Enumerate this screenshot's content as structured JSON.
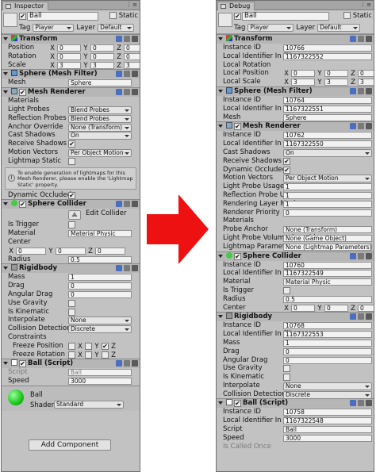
{
  "colors": {
    "panel": "#c2c2c2",
    "accent_arrow": "#ee1111"
  },
  "inspector": {
    "tab_title": "Inspector",
    "go_name": "Ball",
    "static_label": "Static",
    "tag_label": "Tag",
    "tag_value": "Player",
    "layer_label": "Layer",
    "layer_value": "Default",
    "transform": {
      "title": "Transform",
      "rows": [
        {
          "label": "Position",
          "x": "0",
          "y": "0",
          "z": "0"
        },
        {
          "label": "Rotation",
          "x": "0",
          "y": "0",
          "z": "0"
        },
        {
          "label": "Scale",
          "x": "3",
          "y": "3",
          "z": "3"
        }
      ]
    },
    "mesh_filter": {
      "title": "Sphere (Mesh Filter)",
      "mesh_label": "Mesh",
      "mesh_value": "Sphere"
    },
    "mesh_renderer": {
      "title": "Mesh Renderer",
      "rows": [
        {
          "label": "Materials",
          "value": ""
        },
        {
          "label": "Light Probes",
          "value": "Blend Probes"
        },
        {
          "label": "Reflection Probes",
          "value": "Blend Probes"
        },
        {
          "label": "Anchor Override",
          "value": "None (Transform)"
        },
        {
          "label": "Cast Shadows",
          "value": "On"
        },
        {
          "label": "Receive Shadows",
          "value": ""
        },
        {
          "label": "Motion Vectors",
          "value": "Per Object Motion"
        },
        {
          "label": "Lightmap Static",
          "value": ""
        }
      ],
      "help": "To enable generation of lightmaps for this Mesh Renderer, please enable the 'Lightmap Static' property.",
      "dynamic_occluded": "Dynamic Occluded"
    },
    "sphere_collider": {
      "title": "Sphere Collider",
      "edit_collider": "Edit Collider",
      "is_trigger": "Is Trigger",
      "material_label": "Material",
      "material_value": "Material Physic",
      "center_label": "Center",
      "cx": "0",
      "cy": "0",
      "cz": "0",
      "radius_label": "Radius",
      "radius_value": "0.5"
    },
    "rigidbody": {
      "title": "Rigidbody",
      "rows": [
        {
          "label": "Mass",
          "value": "1"
        },
        {
          "label": "Drag",
          "value": "0"
        },
        {
          "label": "Angular Drag",
          "value": "0"
        }
      ],
      "use_gravity": "Use Gravity",
      "is_kinematic": "Is Kinematic",
      "interpolate_label": "Interpolate",
      "interpolate_value": "None",
      "collision_label": "Collision Detection",
      "collision_value": "Discrete",
      "constraints": "Constraints",
      "freeze_pos": "Freeze Position",
      "freeze_rot": "Freeze Rotation"
    },
    "script": {
      "title": "Ball (Script)",
      "script_label": "Script",
      "script_value": "Ball",
      "speed_label": "Speed",
      "speed_value": "3000"
    },
    "material": {
      "name": "Ball",
      "shader_label": "Shader",
      "shader_value": "Standard"
    },
    "add_component": "Add Component"
  },
  "debug": {
    "tab_title": "Debug",
    "go_name": "Ball",
    "static_label": "Static",
    "tag_label": "Tag",
    "tag_value": "Player",
    "layer_label": "Layer",
    "layer_value": "Default",
    "transform": {
      "title": "Transform",
      "instance_id": "10766",
      "local_id": "1167322552",
      "instance_label": "Instance ID",
      "local_label": "Local Identifier In File",
      "rot_label": "Local Rotation",
      "pos_label": "Local Position",
      "scale_label": "Local Scale",
      "px": "0",
      "py": "0",
      "pz": "0",
      "sx": "3",
      "sy": "3",
      "sz": "3"
    },
    "mesh_filter": {
      "title": "Sphere (Mesh Filter)",
      "instance_id": "10764",
      "local_id": "1167322551",
      "mesh_label": "Mesh",
      "mesh_value": "Sphere"
    },
    "mesh_renderer": {
      "title": "Mesh Renderer",
      "instance_id": "10762",
      "local_id": "1167322550",
      "rows": [
        {
          "label": "Cast Shadows",
          "value": "On"
        },
        {
          "label": "Receive Shadows",
          "value": ""
        },
        {
          "label": "Dynamic Occludee",
          "value": ""
        },
        {
          "label": "Motion Vectors",
          "value": "Per Object Motion"
        },
        {
          "label": "Light Probe Usage",
          "value": "1"
        },
        {
          "label": "Reflection Probe Usage",
          "value": "1"
        },
        {
          "label": "Rendering Layer Mask",
          "value": "1"
        },
        {
          "label": "Renderer Priority",
          "value": "0"
        },
        {
          "label": "Materials",
          "value": ""
        },
        {
          "label": "Probe Anchor",
          "value": "None (Transform)"
        },
        {
          "label": "Light Probe Volume Override",
          "value": "None (Game Object)"
        },
        {
          "label": "Lightmap Parameters",
          "value": "None (Lightmap Parameters)"
        }
      ]
    },
    "sphere_collider": {
      "title": "Sphere Collider",
      "instance_id": "10760",
      "local_id": "1167322549",
      "material_value": "Material Physic",
      "radius_value": "0.5",
      "is_trigger": "Is Trigger",
      "material_label": "Material",
      "radius_label": "Radius",
      "center_label": "Center",
      "cx": "0",
      "cy": "0",
      "cz": "0"
    },
    "rigidbody": {
      "title": "Rigidbody",
      "instance_id": "10768",
      "local_id": "1167322553",
      "rows": [
        {
          "label": "Mass",
          "value": "1"
        },
        {
          "label": "Drag",
          "value": "0"
        },
        {
          "label": "Angular Drag",
          "value": "0"
        }
      ],
      "use_gravity": "Use Gravity",
      "is_kinematic": "Is Kinematic",
      "interpolate_label": "Interpolate",
      "interpolate_value": "None",
      "collision_label": "Collision Detection",
      "collision_value": "Discrete"
    },
    "script": {
      "title": "Ball (Script)",
      "instance_id": "10758",
      "local_id": "1167322548",
      "script_label": "Script",
      "script_value": "Ball",
      "speed_label": "Speed",
      "speed_value": "3000",
      "last_label": "Is Called Once"
    }
  }
}
